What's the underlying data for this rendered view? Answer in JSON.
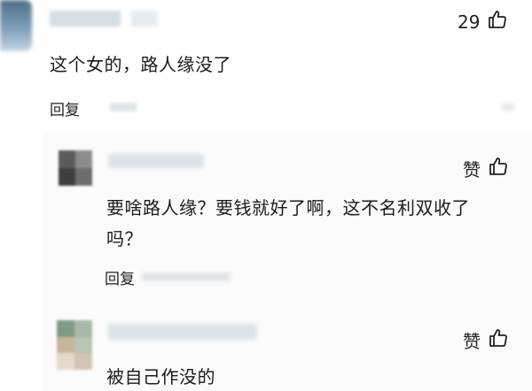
{
  "comments": [
    {
      "text": "这个女的，路人缘没了",
      "likes": "29",
      "reply_label": "回复"
    }
  ],
  "replies": [
    {
      "like_label": "赞",
      "text_line1": "要啥路人缘？要钱就好了啊，这不名利双收了",
      "text_line2": "吗？",
      "reply_label": "回复"
    },
    {
      "like_label": "赞",
      "text": "被自己作没的"
    }
  ],
  "icons": {
    "thumb": "thumbs-up-icon"
  }
}
